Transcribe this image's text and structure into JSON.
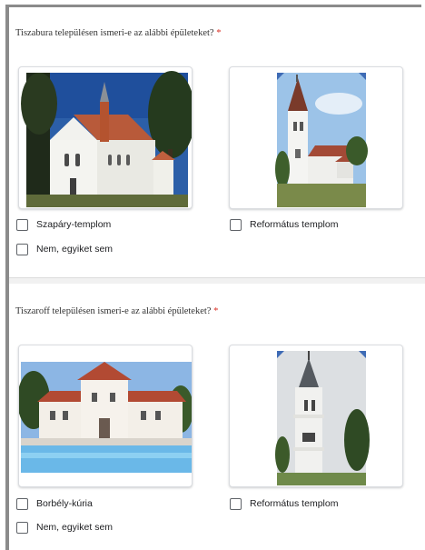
{
  "questions": [
    {
      "place": "Tiszabura",
      "text_rest": " településen ismeri-e az alábbi épületeket?",
      "required": "*",
      "options": [
        "Szapáry-templom",
        "Református templom",
        "Nem, egyiket sem"
      ],
      "images": [
        "church-photo",
        "church-tower-photo"
      ]
    },
    {
      "place": "Tiszaroff",
      "text_rest": " településen ismeri-e az alábbi épületeket?",
      "required": "*",
      "options": [
        "Borbély-kúria",
        "Református templom",
        "Nem, egyiket sem"
      ],
      "images": [
        "manor-pool-photo",
        "church-tower-photo"
      ]
    }
  ],
  "colors": {
    "required": "#d93025",
    "checkbox_border": "#5f6368",
    "card_border": "#dadce0"
  }
}
